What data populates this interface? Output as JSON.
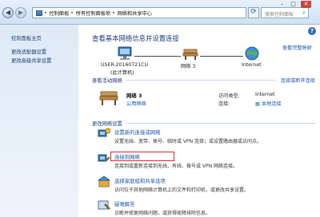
{
  "addressbar": {
    "crumbs": [
      "控制面板",
      "所有控制面板项",
      "网络和共享中心"
    ],
    "search_placeholder": "搜索控制面板"
  },
  "sidebar": {
    "items": [
      {
        "label": "控制面板主页"
      },
      {
        "label": "更改适配器设置"
      },
      {
        "label": "更改高级共享设置"
      }
    ]
  },
  "main": {
    "heading": "查看基本网络信息并设置连接",
    "full_map_link": "查看完整映射",
    "nodes": [
      {
        "label": "USER-20160721CU",
        "sublabel": "(此计算机)"
      },
      {
        "label": "网络 3"
      },
      {
        "label": "Internet"
      }
    ],
    "active_section": {
      "label": "查看活动网络",
      "connect_link": "连接或断开连接",
      "network_name": "网络 3",
      "network_category": "公用网络",
      "access_type_label": "访问类型:",
      "access_type_value": "Internet",
      "connection_label": "连接:",
      "connection_value": "本地连接"
    },
    "change_section": {
      "label": "更改网络设置",
      "tasks": [
        {
          "title": "设置新的连接或网络",
          "desc": "设置无线、宽带、拨号、临时或 VPN 连接；或设置路由器或访问点。"
        },
        {
          "title": "连接到网络",
          "desc": "连接到或重新连接到无线、有线、拨号或 VPN 网络连接。"
        },
        {
          "title": "选择家庭组和共享选项",
          "desc": "访问位于其他网络计算机上的文件和打印机，或更改共享设置。"
        },
        {
          "title": "疑难解答",
          "desc": "诊断并修复网络问题，或获得故障排除信息。"
        }
      ]
    }
  },
  "colors": {
    "link": "#1a55a8",
    "highlight": "#d42a2a",
    "heading": "#1d3c78"
  }
}
